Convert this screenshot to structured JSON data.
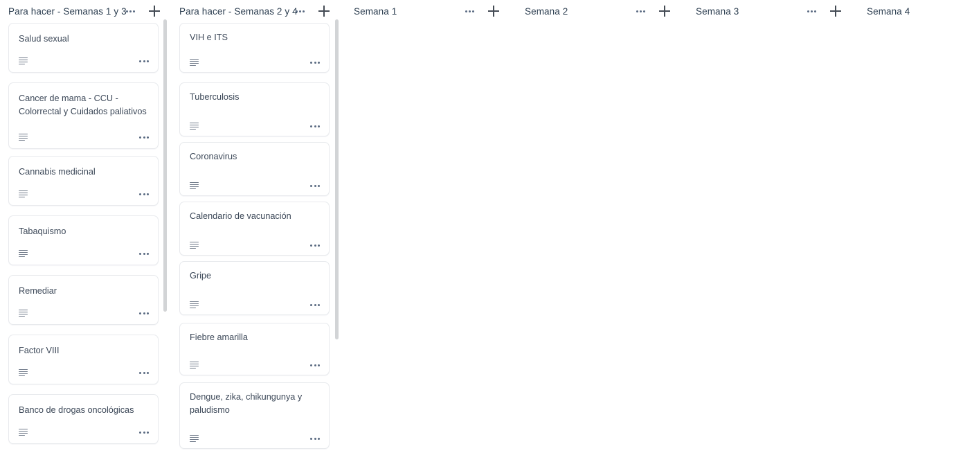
{
  "board": {
    "background_color": "#ffffff",
    "card_border_color": "#e8eaed",
    "text_color": "#3c4858",
    "scrollbar_color": "#d2d4d6"
  },
  "columns": [
    {
      "title": "Para hacer - Semanas 1 y 3",
      "menu_label": "list-menu",
      "add_label": "add-card",
      "has_menu": true,
      "has_add": true,
      "cards": [
        {
          "title": "Salud sexual",
          "has_description": true
        },
        {
          "title": "Cancer de mama - CCU - Colorrectal y Cuidados paliativos",
          "has_description": true
        },
        {
          "title": "Cannabis medicinal",
          "has_description": true
        },
        {
          "title": "Tabaquismo",
          "has_description": true
        },
        {
          "title": "Remediar",
          "has_description": true
        },
        {
          "title": "Factor VIII",
          "has_description": true
        },
        {
          "title": "Banco de drogas oncológicas",
          "has_description": true
        }
      ]
    },
    {
      "title": "Para hacer - Semanas 2 y 4",
      "menu_label": "list-menu",
      "add_label": "add-card",
      "has_menu": true,
      "has_add": true,
      "cards": [
        {
          "title": "VIH e ITS",
          "has_description": true
        },
        {
          "title": "Tuberculosis",
          "has_description": true
        },
        {
          "title": "Coronavirus",
          "has_description": true
        },
        {
          "title": "Calendario de vacunación",
          "has_description": true
        },
        {
          "title": "Gripe",
          "has_description": true
        },
        {
          "title": "Fiebre amarilla",
          "has_description": true
        },
        {
          "title": "Dengue, zika, chikungunya y paludismo",
          "has_description": true
        }
      ]
    },
    {
      "title": "Semana 1",
      "menu_label": "list-menu",
      "add_label": "add-card",
      "has_menu": true,
      "has_add": true,
      "cards": []
    },
    {
      "title": "Semana 2",
      "menu_label": "list-menu",
      "add_label": "add-card",
      "has_menu": true,
      "has_add": true,
      "cards": []
    },
    {
      "title": "Semana 3",
      "menu_label": "list-menu",
      "add_label": "add-card",
      "has_menu": true,
      "has_add": true,
      "cards": []
    },
    {
      "title": "Semana 4",
      "menu_label": "list-menu",
      "add_label": "add-card",
      "has_menu": false,
      "has_add": false,
      "cards": []
    }
  ]
}
